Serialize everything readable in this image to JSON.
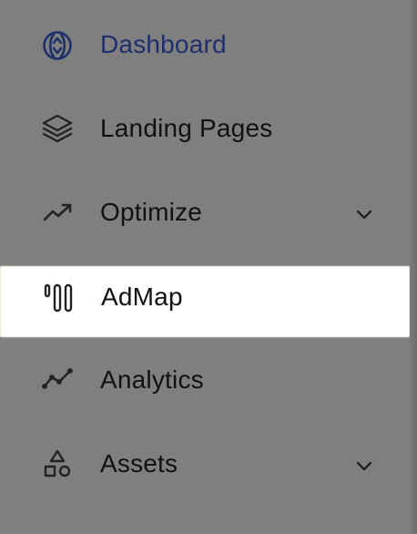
{
  "sidebar": {
    "items": [
      {
        "label": "Dashboard",
        "icon": "dashboard-icon",
        "active": false,
        "highlighted_text": true
      },
      {
        "label": "Landing Pages",
        "icon": "layers-icon",
        "active": false
      },
      {
        "label": "Optimize",
        "icon": "trending-up-icon",
        "active": false,
        "has_submenu": true
      },
      {
        "label": "AdMap",
        "icon": "admap-icon",
        "active": true
      },
      {
        "label": "Analytics",
        "icon": "analytics-icon",
        "active": false
      },
      {
        "label": "Assets",
        "icon": "shapes-icon",
        "active": false,
        "has_submenu": true
      }
    ],
    "colors": {
      "background": "#7f7f7f",
      "active_background": "#ffffff",
      "dashboard_label": "#1f2f6b",
      "label": "#111111",
      "icon": "#222222"
    }
  }
}
